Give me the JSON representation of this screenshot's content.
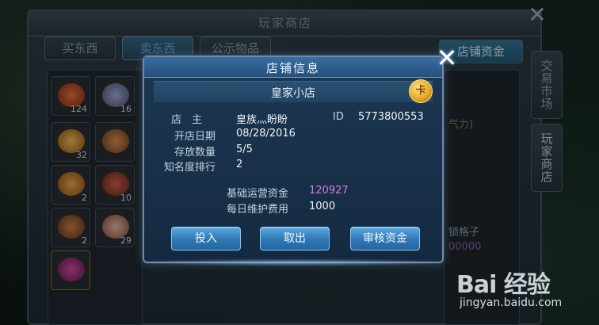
{
  "shop_window": {
    "title": "玩家商店",
    "tabs": [
      {
        "label": "买东西",
        "active": false
      },
      {
        "label": "卖东西",
        "active": true
      },
      {
        "label": "公示物品",
        "active": false
      }
    ],
    "funds_button": "店铺资金",
    "side_tabs": [
      "交易市场",
      "玩家商店"
    ],
    "inventory_counts": [
      "124",
      "16",
      "32",
      "2",
      "10",
      "2",
      "29"
    ],
    "behind_text": {
      "tag": "气力)",
      "locked_slot": "锁格子",
      "price": "00000"
    }
  },
  "dialog": {
    "title": "店铺信息",
    "shop_name": "皇家小店",
    "badge": "卡",
    "owner_label": "店　主",
    "owner_value": "皇族灬盼盼",
    "id_label": "ID",
    "id_value": "5773800553",
    "open_date_label": "开店日期",
    "open_date_value": "08/28/2016",
    "storage_label": "存放数量",
    "storage_value": "5/5",
    "rank_label": "知名度排行",
    "rank_value": "2",
    "base_funds_label": "基础运营资金",
    "base_funds_value": "120927",
    "daily_fee_label": "每日维护费用",
    "daily_fee_value": "1000",
    "buttons": {
      "invest": "投入",
      "withdraw": "取出",
      "audit": "审核资金"
    }
  },
  "watermark": {
    "logo": "Bai 经验",
    "url": "jingyan.baidu.com"
  },
  "colors": {
    "dialog_bg": "#183049",
    "button": "#2f77b4",
    "highlight": "#d77ce0"
  }
}
